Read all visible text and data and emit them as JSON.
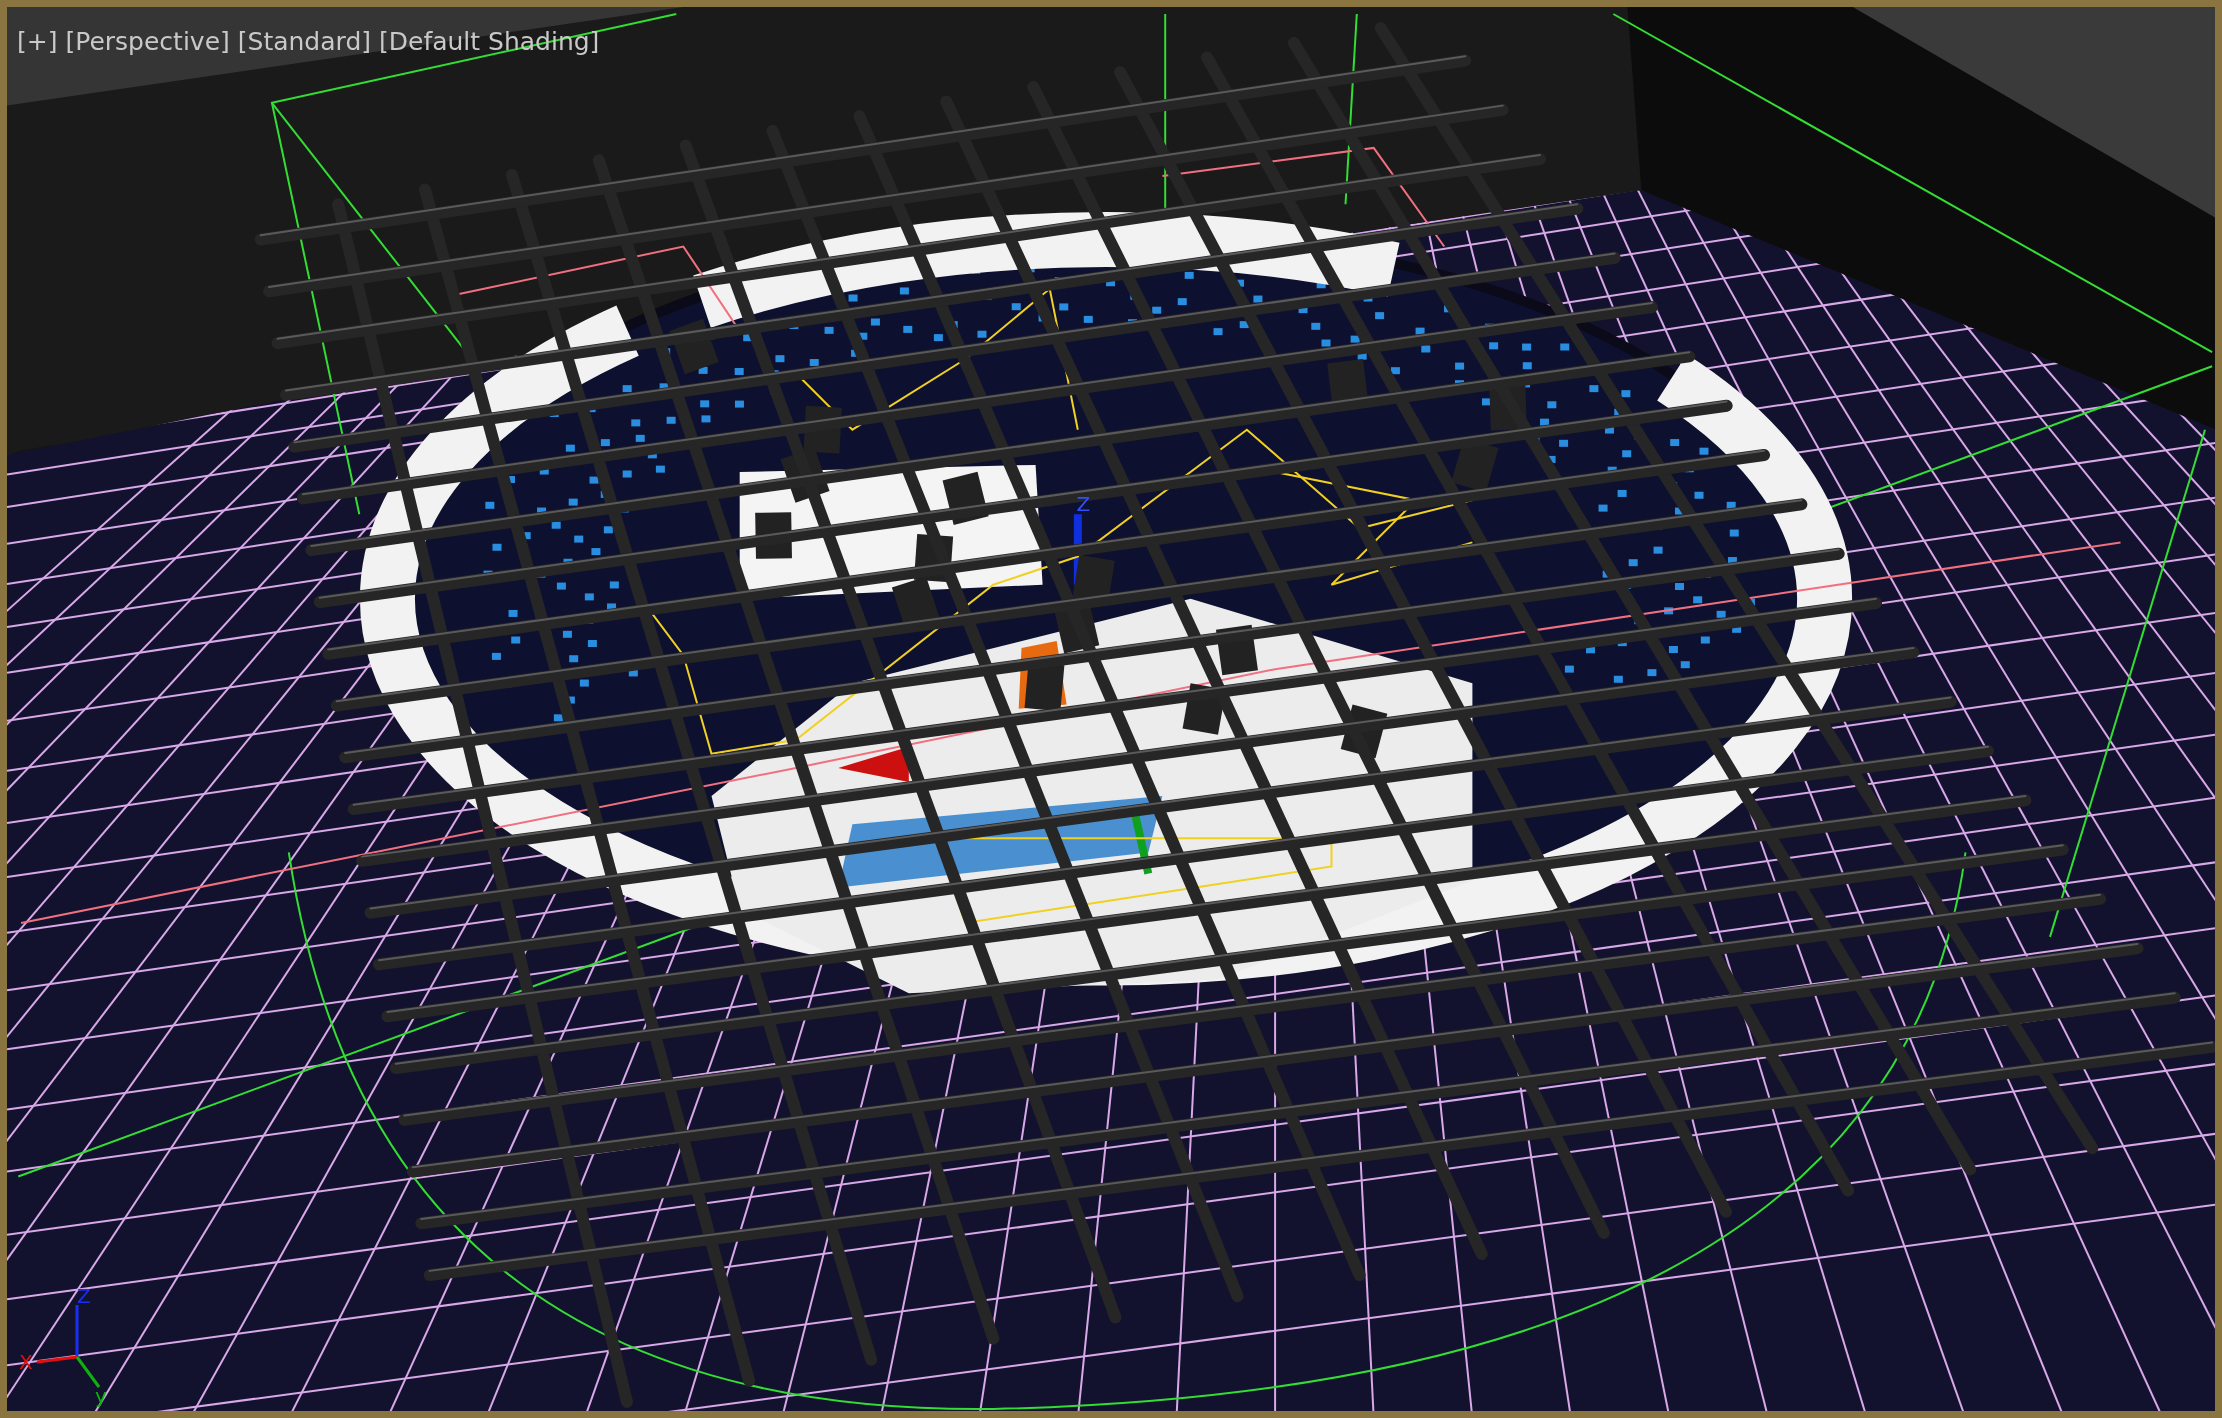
{
  "viewport": {
    "labels": [
      {
        "text": "[+]"
      },
      {
        "text": "[Perspective]"
      },
      {
        "text": "[Standard]"
      },
      {
        "text": "[Default Shading]"
      }
    ],
    "gizmo_label": "Z",
    "axis_tripod": {
      "x": "X",
      "y": "y",
      "z": "Z"
    }
  }
}
